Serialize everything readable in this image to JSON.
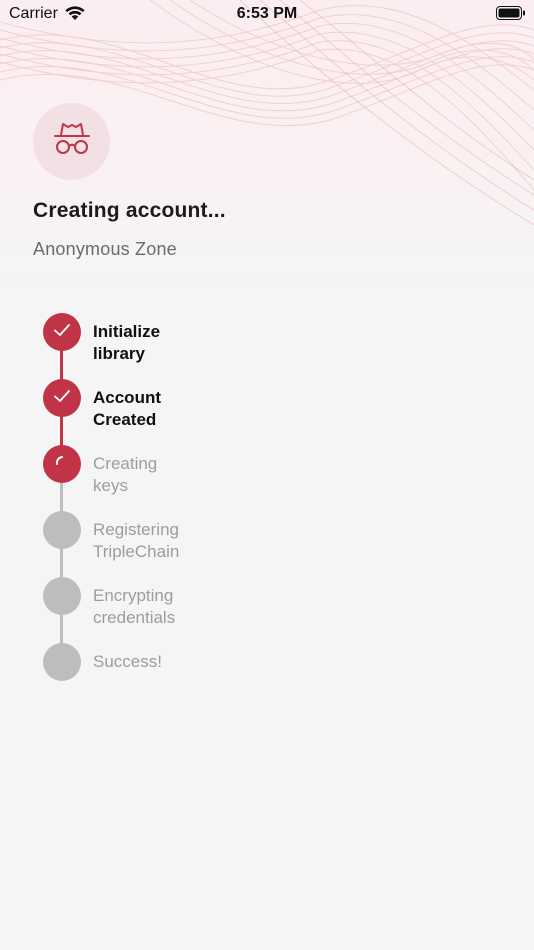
{
  "status_bar": {
    "carrier": "Carrier",
    "time": "6:53 PM"
  },
  "header": {
    "avatar_icon": "incognito-icon",
    "title": "Creating account...",
    "subtitle": "Anonymous Zone"
  },
  "colors": {
    "accent": "#c13447",
    "pending": "#bdbdbd",
    "background": "#f5f5f5"
  },
  "steps": [
    {
      "label": "Initialize library",
      "state": "done"
    },
    {
      "label": "Account Created",
      "state": "done"
    },
    {
      "label": "Creating keys",
      "state": "in-progress"
    },
    {
      "label": "Registering TripleChain",
      "state": "pending"
    },
    {
      "label": "Encrypting credentials",
      "state": "pending"
    },
    {
      "label": "Success!",
      "state": "pending"
    }
  ]
}
